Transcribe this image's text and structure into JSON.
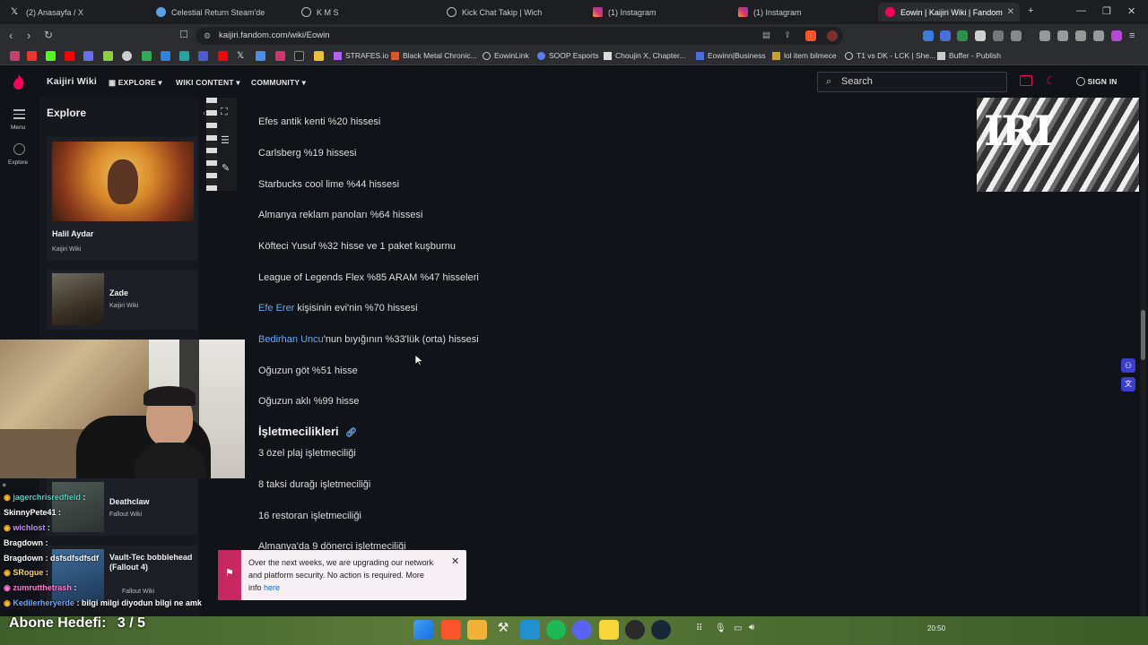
{
  "browser": {
    "tabs": [
      {
        "title": "(2) Anasayfa / X",
        "icon_color": "#e6e6e6"
      },
      {
        "title": "Celestial Return Steam'de",
        "icon_color": "#5aa0e0"
      },
      {
        "title": "K M S",
        "icon_color": "#bbbbbb"
      },
      {
        "title": "Kick Chat Takip | Wich",
        "icon_color": "#bbbbbb"
      },
      {
        "title": "(1) Instagram",
        "icon_color": "#d6336c"
      },
      {
        "title": "(1) Instagram",
        "icon_color": "#d6336c"
      },
      {
        "title": "Eowin | Kaijiri Wiki | Fandom",
        "icon_color": "#fa005a"
      }
    ],
    "url": "kaijiri.fandom.com/wiki/Eowin",
    "bookmarks": [
      "STRAFES.io",
      "Black Metal Chronic...",
      "EowinLink",
      "SOOP Esports",
      "Choujin X, Chapter...",
      "Eowinn|Business",
      "lol item bilmece",
      "T1 vs DK - LCK | She...",
      "Buffer - Publish"
    ]
  },
  "wiki": {
    "brand": "Kaijiri Wiki",
    "nav": [
      "EXPLORE",
      "WIKI CONTENT",
      "COMMUNITY"
    ],
    "search_placeholder": "Search",
    "sign_in": "SIGN IN",
    "rail": {
      "menu": "Menu",
      "explore": "Explore"
    },
    "explore_panel": {
      "title": "Explore",
      "cards": [
        {
          "title": "Halil Aydar",
          "sub": "Kaijiri Wiki"
        },
        {
          "title": "Zade",
          "sub": "Kaijiri Wiki"
        },
        {
          "title": "Deathclaw",
          "sub": "Fallout Wiki"
        },
        {
          "title": "Vault-Tec bobblehead (Fallout 4)",
          "sub": "Fallout Wiki"
        }
      ]
    },
    "content": {
      "lines": [
        {
          "text": "Efes antik kenti %20 hissesi"
        },
        {
          "text": "Carlsberg %19 hissesi"
        },
        {
          "text": "Starbucks cool lime %44 hissesi"
        },
        {
          "text": "Almanya reklam panoları %64 hissesi"
        },
        {
          "text": "Köfteci Yusuf %32 hisse ve 1 paket kuşburnu"
        },
        {
          "text": "League of Legends Flex %85 ARAM %47 hisseleri"
        },
        {
          "link": "Efe Erer",
          "text": " kişisinin evi'nin %70 hissesi"
        },
        {
          "link": "Bedirhan Uncu",
          "text": "'nun bıyığının %33'lük (orta) hissesi"
        },
        {
          "text": "Oğuzun göt %51 hisse"
        },
        {
          "text": "Oğuzun aklı %99 hisse"
        }
      ],
      "section_heading": "İşletmecilikleri",
      "section_lines": [
        "3 özel plaj işletmeciliği",
        "8 taksi durağı işletmeciliği",
        "16 restoran işletmeciliği",
        "Almanya'da 9 dönerci işletmeciliği"
      ]
    },
    "banner": {
      "text": "Over the next weeks, we are upgrading our network and platform security. No action is required. More info ",
      "link": "here"
    }
  },
  "stream": {
    "chat": [
      {
        "user": "jagerchrisredfield",
        "msg": ":",
        "color": "#3fd5c8"
      },
      {
        "user": "SkinnyPete41",
        "msg": ":",
        "color": "#ffffff"
      },
      {
        "user": "wichlost",
        "msg": ":",
        "color": "#c58cff"
      },
      {
        "user": "Bragdown",
        "msg": ":",
        "color": "#ffffff"
      },
      {
        "user": "Bragdown",
        "msg": ": dsfsdfsdfsdf",
        "color": "#ffffff"
      },
      {
        "user": "SRogue",
        "msg": ":",
        "color": "#ffd24a"
      },
      {
        "user": "zumrutthetrash",
        "msg": ":",
        "color": "#ff7ad1"
      },
      {
        "user": "Kedilerheryerde",
        "msg": ": bilgi milgi diyodun bilgi ne amk",
        "color": "#6aa8ff"
      }
    ],
    "goal_label": "Abone Hedefi:",
    "goal_value": "3 / 5"
  },
  "taskbar": {
    "time": "20:50"
  }
}
